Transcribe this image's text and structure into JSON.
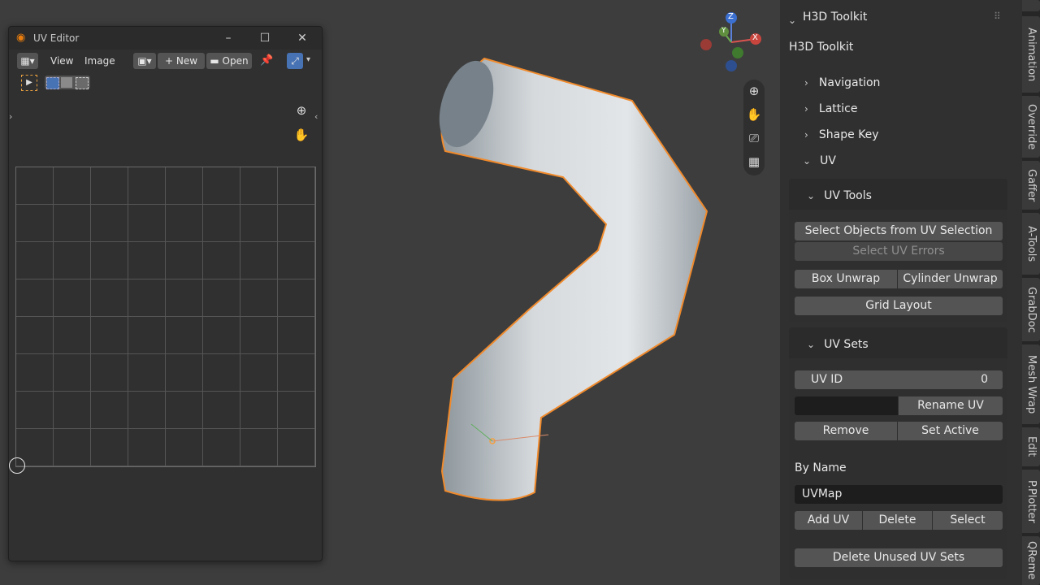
{
  "uv_editor": {
    "title": "UV Editor",
    "menu": {
      "view": "View",
      "image": "Image"
    },
    "new_label": "New",
    "open_label": "Open"
  },
  "toolkit": {
    "header": "H3D Toolkit",
    "title": "H3D Toolkit",
    "sections": [
      "Navigation",
      "Lattice",
      "Shape Key",
      "UV"
    ],
    "uv_tools": {
      "title": "UV Tools",
      "select_objects": "Select Objects from UV Selection",
      "select_errors": "Select UV Errors",
      "box_unwrap": "Box Unwrap",
      "cylinder_unwrap": "Cylinder Unwrap",
      "grid_layout": "Grid Layout"
    },
    "uv_sets": {
      "title": "UV Sets",
      "uv_id_label": "UV ID",
      "uv_id_value": "0",
      "rename": "Rename UV",
      "remove": "Remove",
      "set_active": "Set Active",
      "by_name": "By Name",
      "name_value": "UVMap",
      "add": "Add UV",
      "delete": "Delete",
      "select": "Select",
      "delete_unused": "Delete Unused UV Sets"
    }
  },
  "gizmo": {
    "z": "Z",
    "y": "Y",
    "x": "X"
  },
  "tabs": [
    "Animation",
    "Override",
    "Gaffer",
    "A-Tools",
    "GrabDoc",
    "Mesh Wrap",
    "Edit",
    "P.Plotter",
    "QReme"
  ],
  "colors": {
    "accent": "#4772b3",
    "selection": "#f5a03c",
    "panel": "#303030",
    "viewport": "#3d3d3d"
  }
}
